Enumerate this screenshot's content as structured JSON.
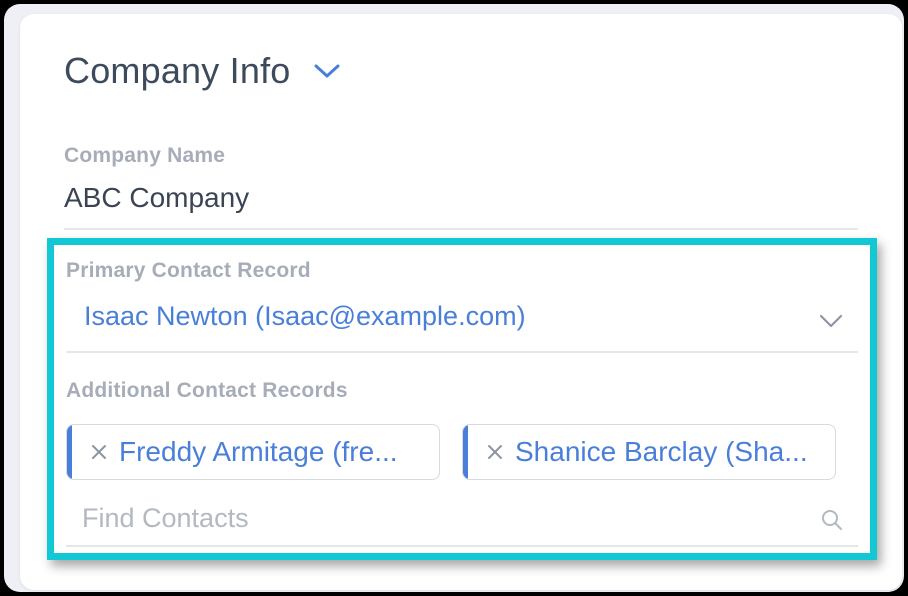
{
  "section": {
    "title": "Company Info"
  },
  "company_name": {
    "label": "Company Name",
    "value": "ABC Company"
  },
  "primary_contact": {
    "label": "Primary Contact Record",
    "value": "Isaac Newton (Isaac@example.com)"
  },
  "additional_contacts": {
    "label": "Additional Contact Records",
    "chips": [
      {
        "label": "Freddy Armitage (fre..."
      },
      {
        "label": "Shanice Barclay (Sha..."
      }
    ],
    "search_placeholder": "Find Contacts"
  },
  "colors": {
    "accent_blue": "#4a7fd9",
    "highlight_teal": "#12c8d4",
    "label_gray": "#a7adb8",
    "text_dark": "#3a4454"
  },
  "icons": {
    "section_toggle": "chevron-down-icon",
    "dropdown": "chevron-down-icon",
    "chip_remove": "close-icon",
    "search": "search-icon"
  }
}
